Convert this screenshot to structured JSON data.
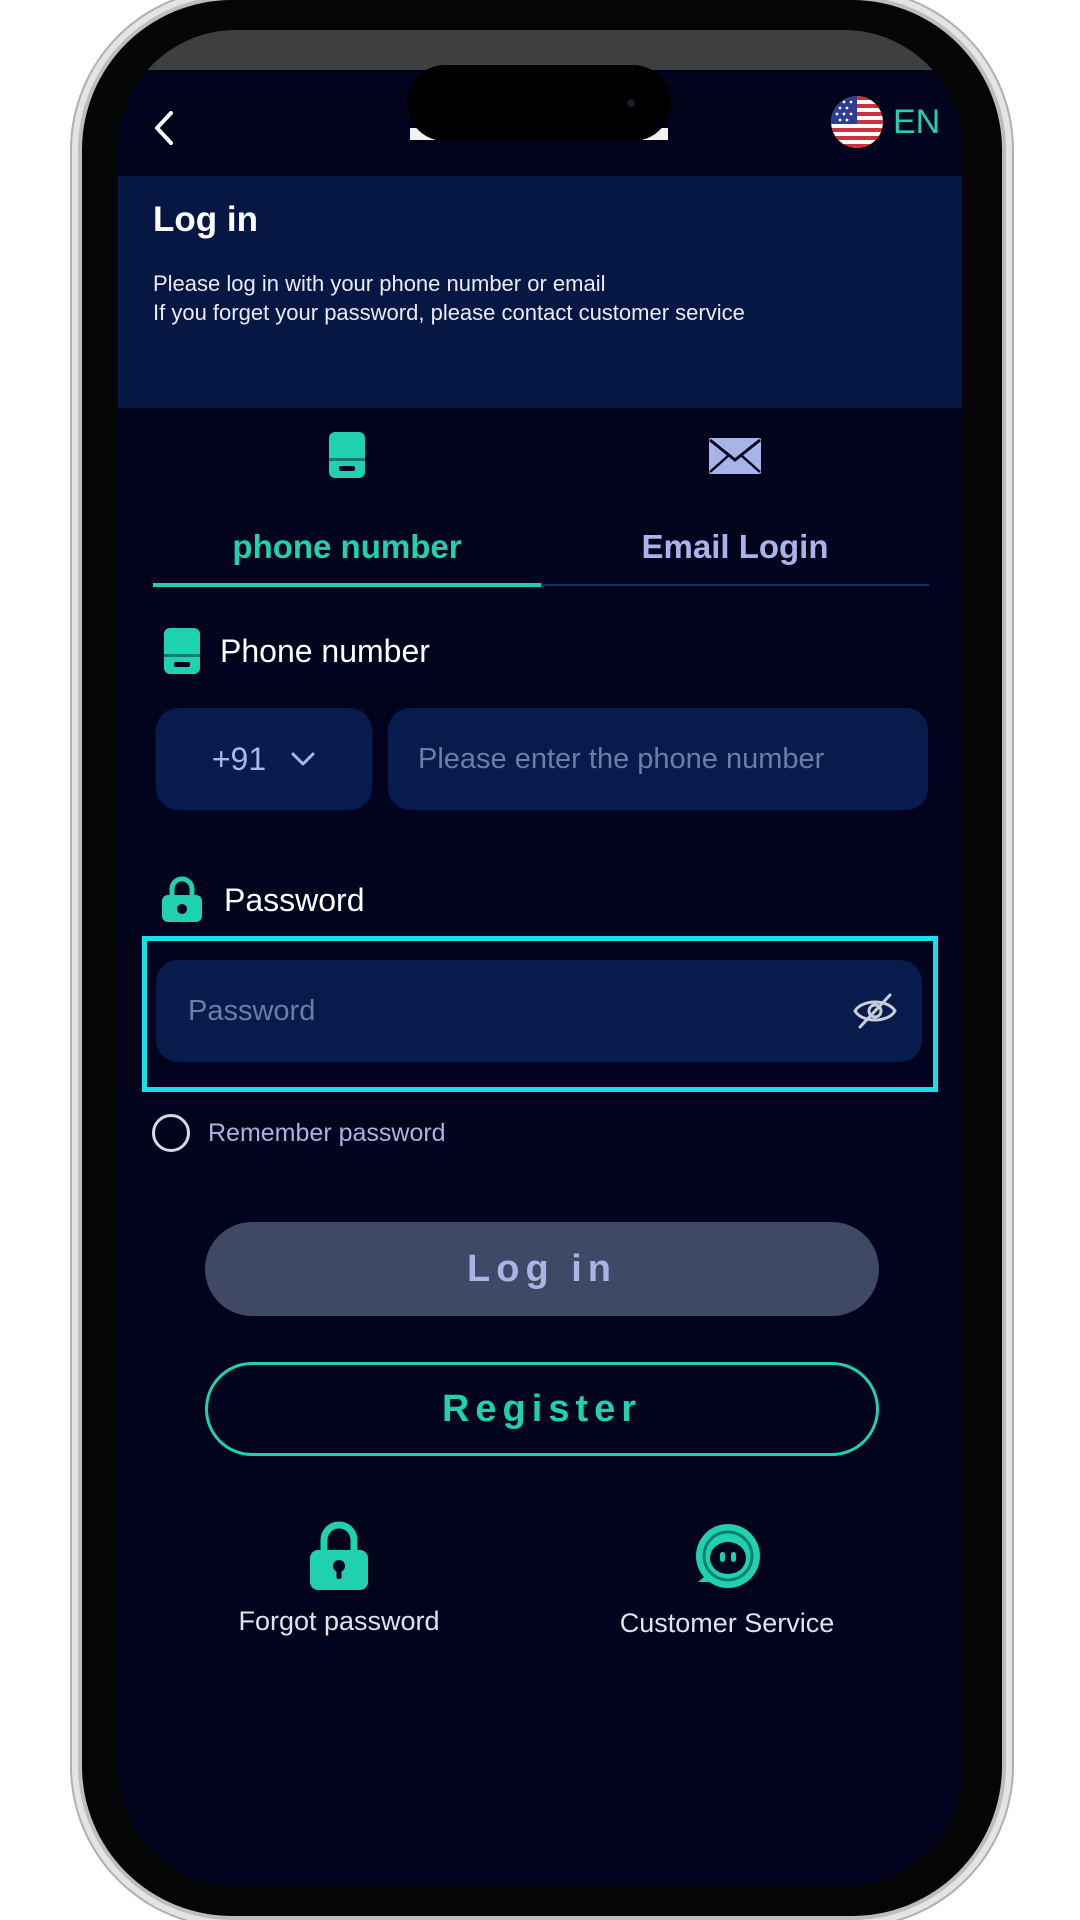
{
  "topbar": {
    "back_icon": "chevron-left-icon",
    "language_code": "EN",
    "flag_icon": "us-flag-icon"
  },
  "header": {
    "title": "Log in",
    "line1": "Please log in with your phone number or email",
    "line2": "If you forget your password, please contact customer service"
  },
  "tabs": [
    {
      "label": "phone number",
      "icon": "phone-icon",
      "active": true
    },
    {
      "label": "Email Login",
      "icon": "envelope-icon",
      "active": false
    }
  ],
  "phone_field": {
    "label": "Phone number",
    "country_code": "+91",
    "placeholder": "Please enter the phone number"
  },
  "password_field": {
    "label": "Password",
    "placeholder": "Password",
    "toggle_icon": "eye-off-icon"
  },
  "remember": {
    "label": "Remember password"
  },
  "buttons": {
    "login": "Log in",
    "register": "Register"
  },
  "footer": {
    "forgot": "Forgot password",
    "service": "Customer Service"
  },
  "colors": {
    "accent": "#1fd1b0",
    "background": "#02031d",
    "panel": "#061743",
    "input": "#071b4d",
    "highlight": "#16e0ea",
    "login_button": "#3f4865"
  }
}
